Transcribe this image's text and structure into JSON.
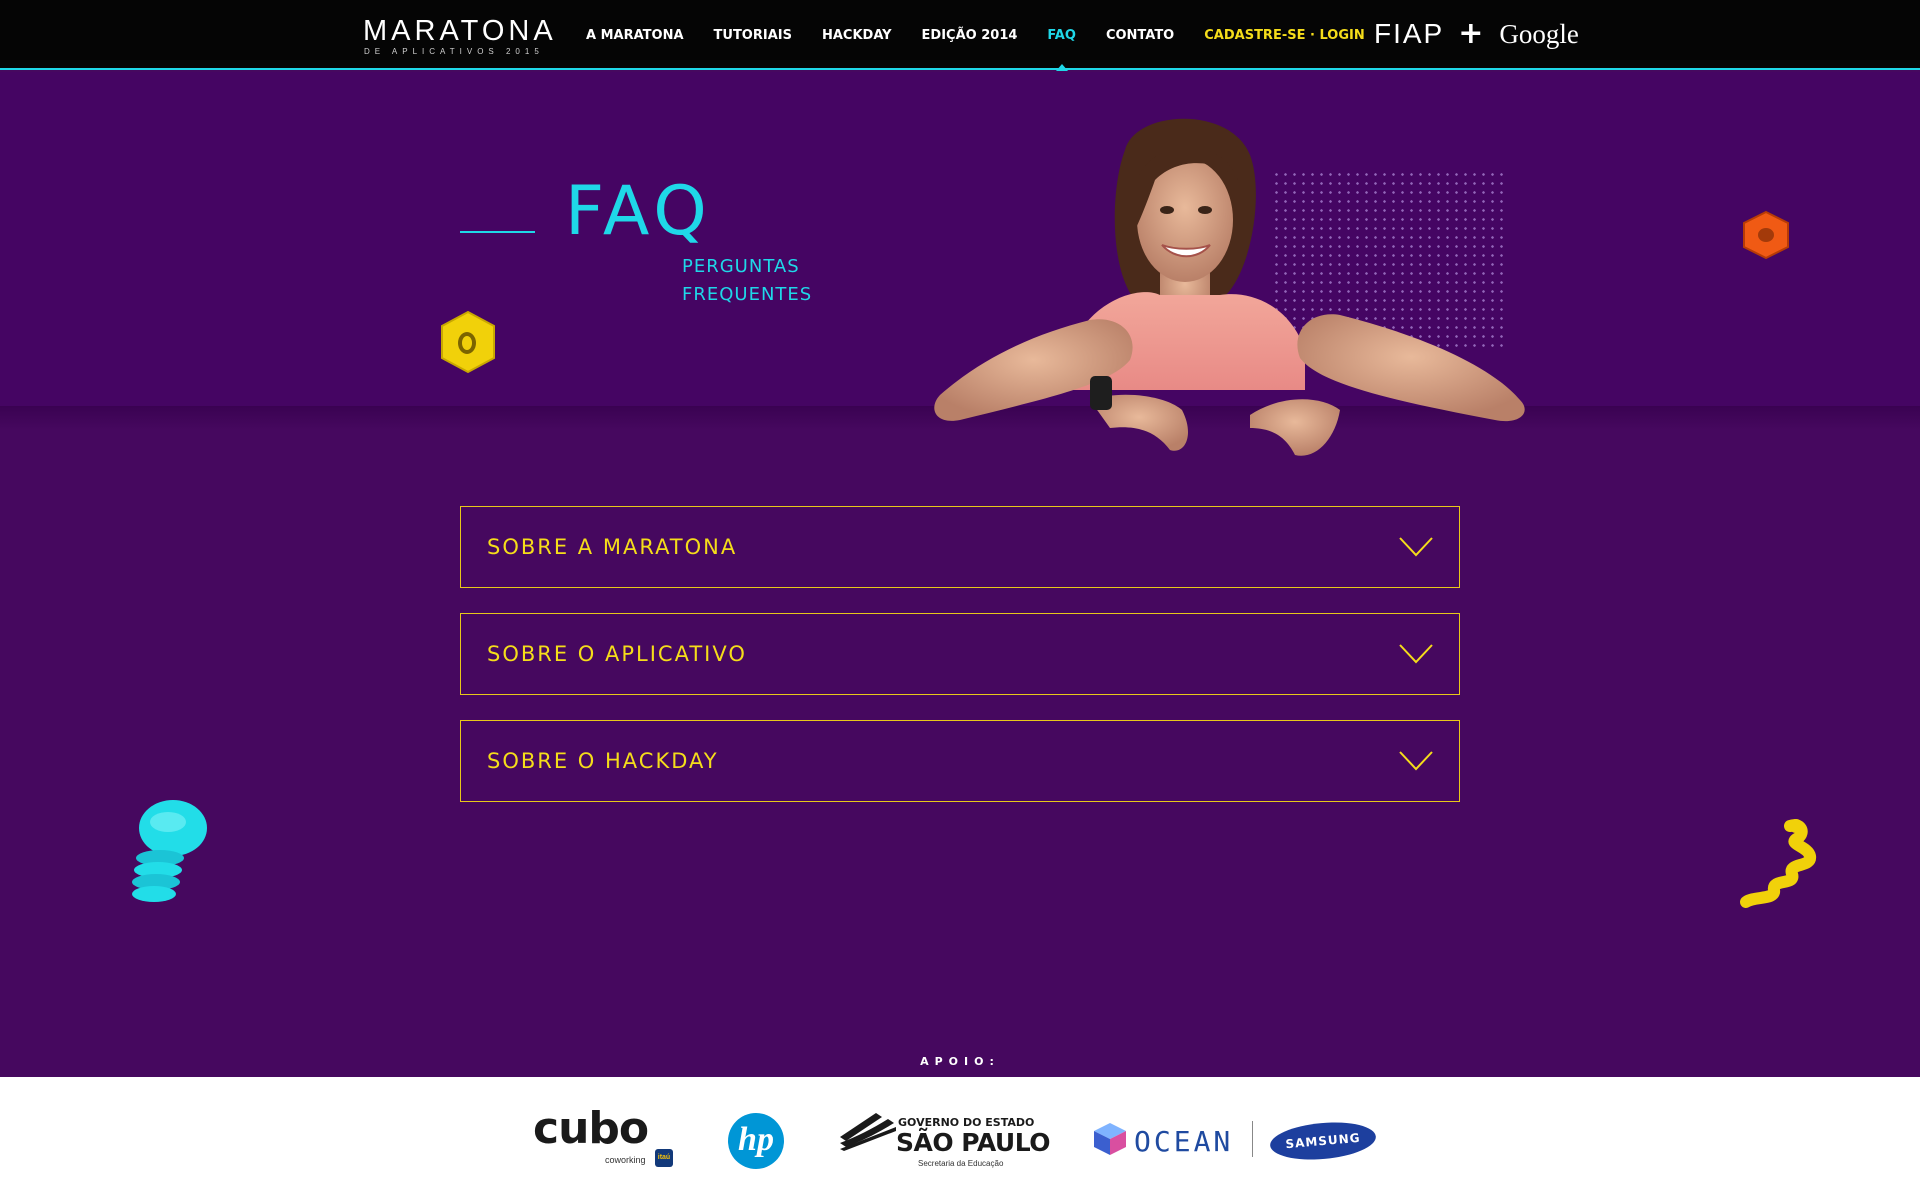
{
  "header": {
    "logo_title": "MARATONA",
    "logo_subtitle": "DE APLICATIVOS 2015",
    "nav_items": [
      {
        "label": "A MARATONA"
      },
      {
        "label": "TUTORIAIS"
      },
      {
        "label": "HACKDAY"
      },
      {
        "label": "EDIÇÃO 2014"
      },
      {
        "label": "FAQ",
        "active": true
      },
      {
        "label": "CONTATO"
      }
    ],
    "signup_label": "CADASTRE-SE · LOGIN",
    "partner_1": "FIAP",
    "partner_plus": "+",
    "partner_2": "Google"
  },
  "hero": {
    "title": "FAQ",
    "subtitle_line1": "PERGUNTAS",
    "subtitle_line2": "FREQUENTES"
  },
  "faq": {
    "items": [
      {
        "label": "SOBRE A MARATONA"
      },
      {
        "label": "SOBRE O APLICATIVO"
      },
      {
        "label": "SOBRE O HACKDAY"
      }
    ]
  },
  "footer": {
    "apoio_label": "APOIO:",
    "sponsors": {
      "cubo": "cubo",
      "cubo_sub": "coworking",
      "itau": "itaú",
      "hp": "hp",
      "sp_title": "GOVERNO DO ESTADO",
      "sp_main": "SÃO PAULO",
      "sp_sub": "Secretaria da Educação",
      "ocean": "OCEAN",
      "samsung": "SAMSUNG"
    }
  },
  "colors": {
    "background": "#46085f",
    "accent_cyan": "#1fd8e8",
    "accent_yellow": "#f5dd1a",
    "nav_bg": "#050505"
  },
  "icons": [
    "chevron-down-icon",
    "hex-nut-icon",
    "screw-icon",
    "spring-icon",
    "ocean-cube-icon"
  ]
}
